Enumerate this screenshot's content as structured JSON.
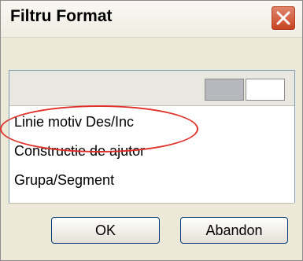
{
  "window": {
    "title": "Filtru Format"
  },
  "titlebar": {
    "close_icon": "close-icon"
  },
  "list": {
    "header": {
      "swatches": [
        "#b7b7be",
        "#ffffff"
      ]
    },
    "items": [
      {
        "label": "Linie motiv Des/Inc"
      },
      {
        "label": "Constructie de ajutor"
      },
      {
        "label": "Grupa/Segment"
      }
    ]
  },
  "buttons": {
    "ok": "OK",
    "cancel": "Abandon"
  },
  "colors": {
    "highlight_ellipse": "#e0302a",
    "close_button": "#c5431d"
  }
}
